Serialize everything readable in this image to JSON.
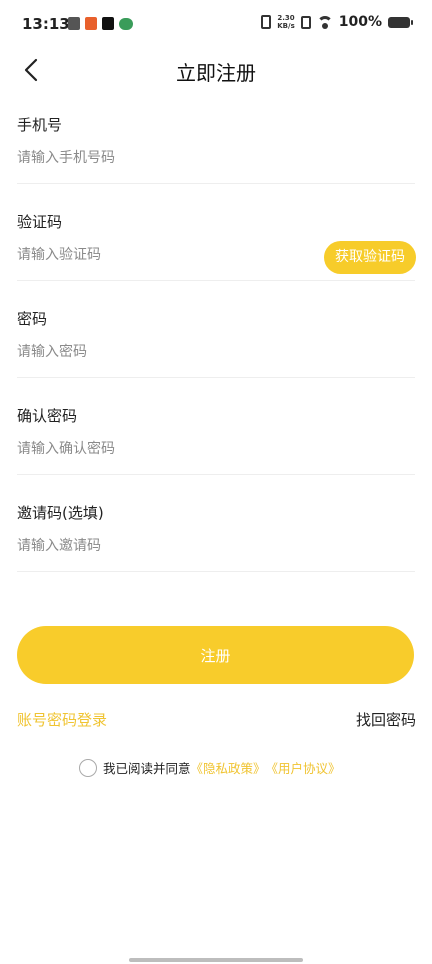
{
  "status_bar": {
    "time": "13:13",
    "net_speed_value": "2.30",
    "net_speed_unit": "KB/s",
    "battery": "100%"
  },
  "nav": {
    "title": "立即注册"
  },
  "form": {
    "phone": {
      "label": "手机号",
      "placeholder": "请输入手机号码",
      "value": ""
    },
    "code": {
      "label": "验证码",
      "placeholder": "请输入验证码",
      "value": "",
      "button": "获取验证码"
    },
    "password": {
      "label": "密码",
      "placeholder": "请输入密码",
      "value": ""
    },
    "confirm": {
      "label": "确认密码",
      "placeholder": "请输入确认密码",
      "value": ""
    },
    "invite": {
      "label": "邀请码(选填)",
      "placeholder": "请输入邀请码",
      "value": ""
    }
  },
  "actions": {
    "register": "注册",
    "login_link": "账号密码登录",
    "forgot_link": "找回密码"
  },
  "agreement": {
    "prefix": "我已阅读并同意",
    "privacy": "《隐私政策》",
    "terms": "《用户协议》"
  },
  "colors": {
    "accent": "#f8cc2b",
    "link": "#f0c432"
  }
}
